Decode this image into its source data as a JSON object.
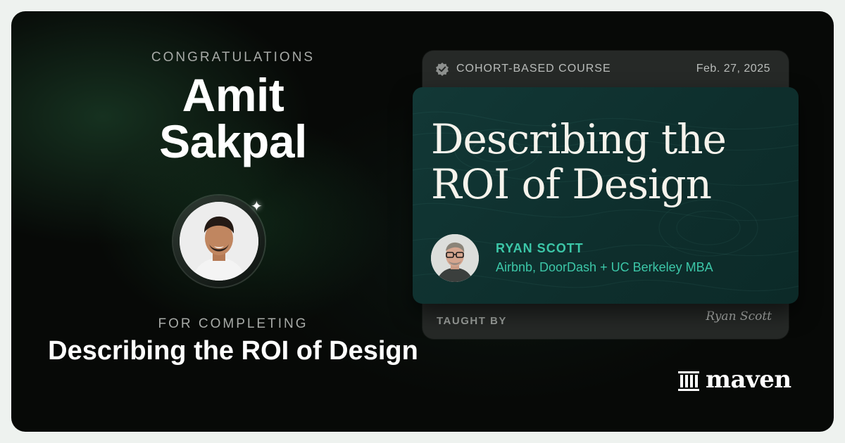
{
  "certificate": {
    "congrats_label": "CONGRATULATIONS",
    "recipient_first": "Amit",
    "recipient_last": "Sakpal",
    "completion_label": "FOR COMPLETING",
    "course_title": "Describing the ROI of Design"
  },
  "course_card": {
    "course_type": "COHORT-BASED COURSE",
    "date": "Feb. 27, 2025",
    "title": "Describing the ROI of Design",
    "instructor_name": "RYAN SCOTT",
    "instructor_bio": "Airbnb, DoorDash + UC Berkeley MBA",
    "taught_by_label": "TAUGHT BY",
    "signature": "Ryan Scott"
  },
  "brand": {
    "name": "maven",
    "accent_color": "#3cc7a8"
  }
}
